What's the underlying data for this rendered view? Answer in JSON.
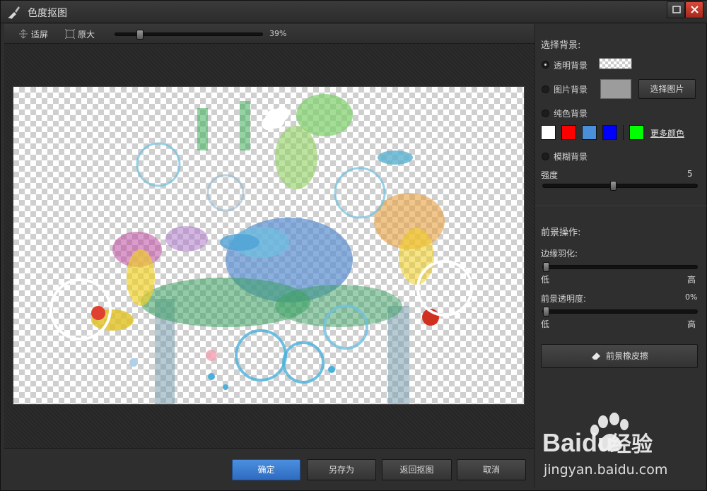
{
  "window": {
    "title": "色度抠图"
  },
  "toolbar": {
    "fit_label": "适屏",
    "actual_label": "原大",
    "zoom_percent": 39,
    "zoom_text": "39%"
  },
  "bottom": {
    "ok": "确定",
    "save_as": "另存为",
    "back": "返回抠图",
    "cancel": "取消"
  },
  "panel": {
    "bg_title": "选择背景:",
    "transparent": "透明背景",
    "image": "图片背景",
    "choose_image": "选择图片",
    "solid": "纯色背景",
    "colors": [
      "#ffffff",
      "#ff0000",
      "#4a90d9",
      "#0000ff",
      "#00ff00"
    ],
    "more_colors": "更多颜色",
    "blur": "模糊背景",
    "strength_label": "强度",
    "strength_value": "5",
    "strength_fraction": 0.45,
    "fg_title": "前景操作:",
    "feather_label": "边缘羽化:",
    "feather_fraction": 0.0,
    "low": "低",
    "high": "高",
    "opacity_label": "前景透明度:",
    "opacity_value": "0%",
    "opacity_fraction": 0.0,
    "eraser": "前景橡皮擦"
  },
  "watermark": {
    "brand_1": "Bai",
    "brand_2": "du",
    "brand_3": "经验",
    "url": "jingyan.baidu.com"
  }
}
